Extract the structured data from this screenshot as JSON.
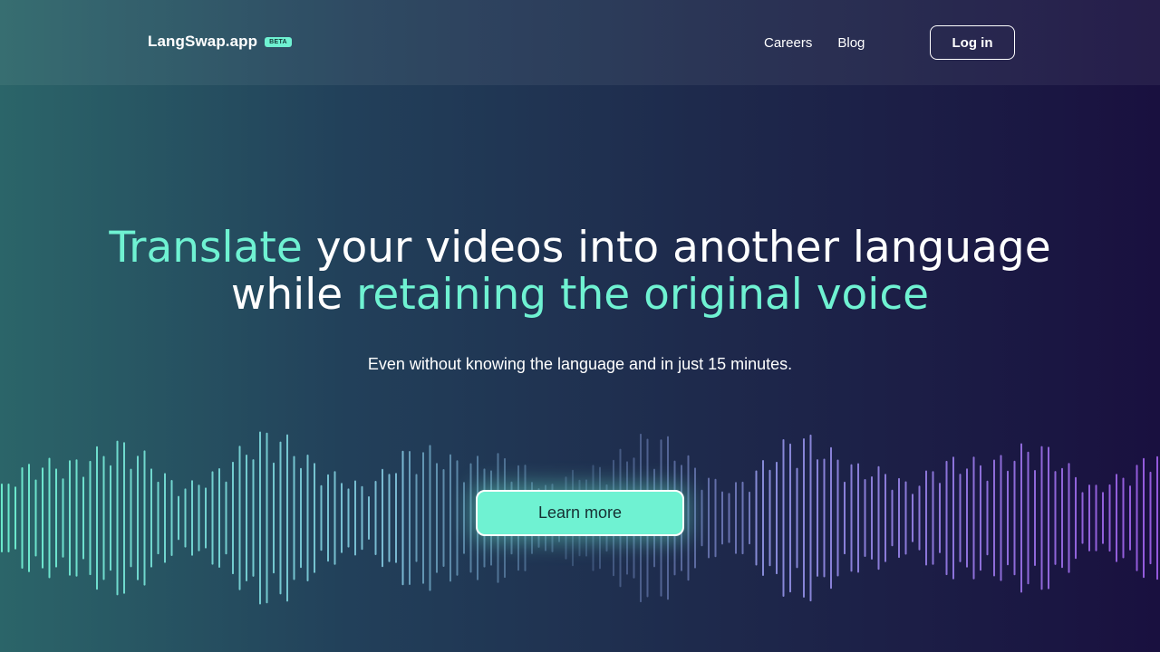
{
  "header": {
    "brand": "LangSwap.app",
    "badge": "BETA",
    "nav": [
      "Careers",
      "Blog"
    ],
    "login_label": "Log in"
  },
  "hero": {
    "line1_accent": "Translate",
    "line1_rest": " your videos into another language",
    "line2_plain": "while ",
    "line2_accent": "retaining the original voice",
    "subtitle": "Even without knowing the language and in just 15 minutes.",
    "cta_label": "Learn more"
  },
  "colors": {
    "accent": "#6ff2d2",
    "wave_left": "#6ff2d2",
    "wave_right": "#9b5de5"
  }
}
